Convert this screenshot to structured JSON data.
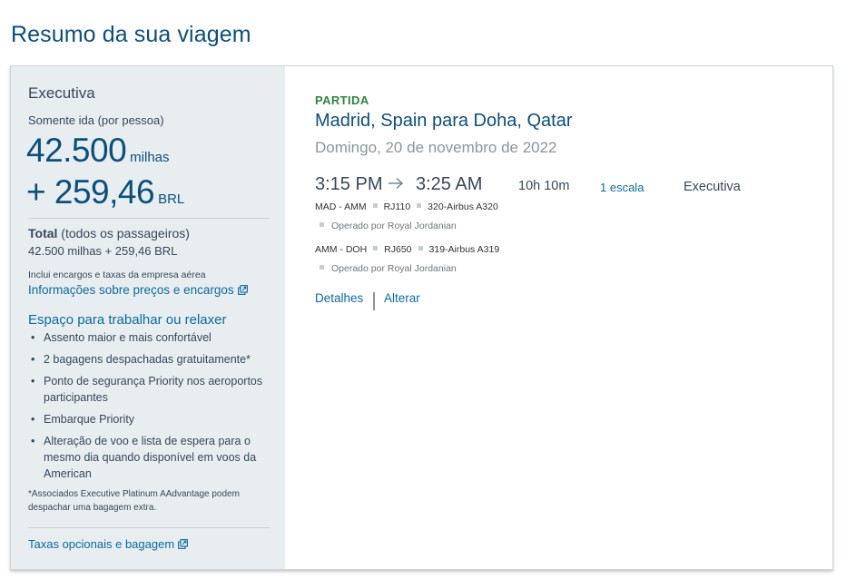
{
  "page": {
    "title": "Resumo da sua viagem"
  },
  "summary": {
    "cabin": "Executiva",
    "trip_note": "Somente ida (por pessoa)",
    "miles": "42.500",
    "miles_unit": "milhas",
    "cash": "+ 259,46",
    "cash_unit": "BRL",
    "total_label": "Total",
    "total_qualifier": "(todos os passageiros)",
    "total_value": "42.500 milhas + 259,46 BRL",
    "fees_note": "Inclui encargos e taxas da empresa aérea",
    "fees_link": "Informações sobre preços e encargos",
    "benefits_title": "Espaço para trabalhar ou relaxer",
    "benefits": [
      "Assento maior e mais confortável",
      "2 bagagens despachadas gratuitamente*",
      "Ponto de segurança Priority nos aeroportos participantes",
      "Embarque Priority",
      "Alteração de voo e lista de espera para o mesmo dia quando disponível em voos da American"
    ],
    "footnote": "*Associados Executive Platinum AAdvantage podem despachar uma bagagem extra.",
    "bags_link": "Taxas opcionais e bagagem"
  },
  "flight": {
    "direction": "PARTIDA",
    "route": "Madrid, Spain para Doha, Qatar",
    "date": "Domingo, 20 de novembro de 2022",
    "depart_time": "3:15 PM",
    "arrive_time": "3:25 AM",
    "duration": "10h 10m",
    "stops": "1 escala",
    "cabin": "Executiva",
    "segments": [
      {
        "route": "MAD - AMM",
        "flight_no": "RJ110",
        "aircraft": "320-Airbus A320",
        "operator": "Operado por Royal Jordanian"
      },
      {
        "route": "AMM - DOH",
        "flight_no": "RJ650",
        "aircraft": "319-Airbus A319",
        "operator": "Operado por Royal Jordanian"
      }
    ],
    "details_link": "Detalhes",
    "change_link": "Alterar"
  },
  "colors": {
    "brand_blue": "#0b4f7c",
    "link_blue": "#0b6aa2",
    "departure_green": "#2e8540",
    "panel_bg": "#e8edf0"
  },
  "icons": [
    "external-link-icon",
    "arrow-right-icon"
  ]
}
